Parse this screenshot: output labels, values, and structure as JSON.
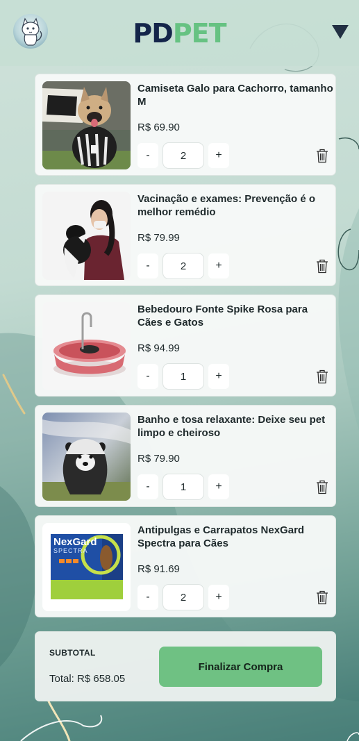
{
  "header": {
    "logo_primary": "PD",
    "logo_accent": "PET",
    "avatar_icon": "cat-avatar-icon",
    "menu_icon": "triangle-down-icon"
  },
  "colors": {
    "logo_primary": "#14254a",
    "logo_accent": "#66c282",
    "checkout_button": "#6fc183",
    "card_background": "#f7f9f8"
  },
  "cart": {
    "items": [
      {
        "name": "Camiseta Galo para Cachorro, tamanho M",
        "price": "R$ 69.90",
        "quantity": "2",
        "decrement_label": "-",
        "increment_label": "+",
        "image_icon": "dog-in-jersey-image",
        "remove_icon": "trash-icon"
      },
      {
        "name": "Vacinação e exames: Prevenção é o melhor remédio",
        "price": "R$ 79.99",
        "quantity": "2",
        "decrement_label": "-",
        "increment_label": "+",
        "image_icon": "vet-with-dog-image",
        "remove_icon": "trash-icon"
      },
      {
        "name": "Bebedouro Fonte Spike Rosa para Cães e Gatos",
        "price": "R$ 94.99",
        "quantity": "1",
        "decrement_label": "-",
        "increment_label": "+",
        "image_icon": "water-fountain-image",
        "remove_icon": "trash-icon"
      },
      {
        "name": "Banho e tosa relaxante: Deixe seu pet limpo e cheiroso",
        "price": "R$ 79.90",
        "quantity": "1",
        "decrement_label": "-",
        "increment_label": "+",
        "image_icon": "dog-bath-image",
        "remove_icon": "trash-icon"
      },
      {
        "name": "Antipulgas e Carrapatos NexGard Spectra para Cães",
        "price": "R$ 91.69",
        "quantity": "2",
        "decrement_label": "-",
        "increment_label": "+",
        "image_icon": "nexgard-box-image",
        "remove_icon": "trash-icon",
        "box_brand": "NexGard",
        "box_subbrand": "SPECTRA"
      }
    ]
  },
  "summary": {
    "subtotal_label": "SUBTOTAL",
    "total_text": "Total: R$ 658.05",
    "checkout_label": "Finalizar Compra"
  }
}
